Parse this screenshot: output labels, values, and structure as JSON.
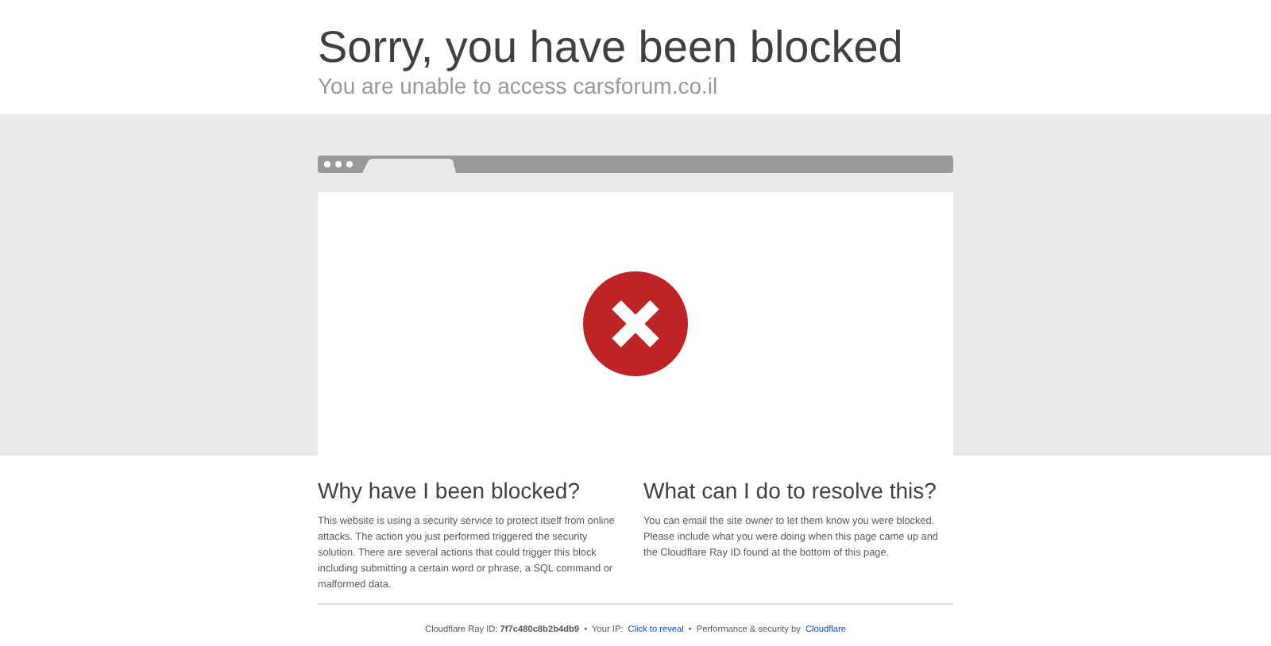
{
  "header": {
    "title": "Sorry, you have been blocked",
    "subtitle": "You are unable to access carsforum.co.il"
  },
  "sections": [
    {
      "heading": "Why have I been blocked?",
      "body": "This website is using a security service to protect itself from online attacks. The action you just performed triggered the security solution. There are several actions that could trigger this block including submitting a certain word or phrase, a SQL command or malformed data."
    },
    {
      "heading": "What can I do to resolve this?",
      "body": "You can email the site owner to let them know you were blocked. Please include what you were doing when this page came up and the Cloudflare Ray ID found at the bottom of this page."
    }
  ],
  "footer": {
    "ray_id": "Cloudflare Ray ID: **7f7c480c8b2b4db9**",
    "separator_1": "•",
    "ip_label": "Your IP:",
    "ip_link": "Click to reveal",
    "separator_2": "•",
    "performance": "Performance & security by",
    "provider_link": "Cloudflare"
  }
}
